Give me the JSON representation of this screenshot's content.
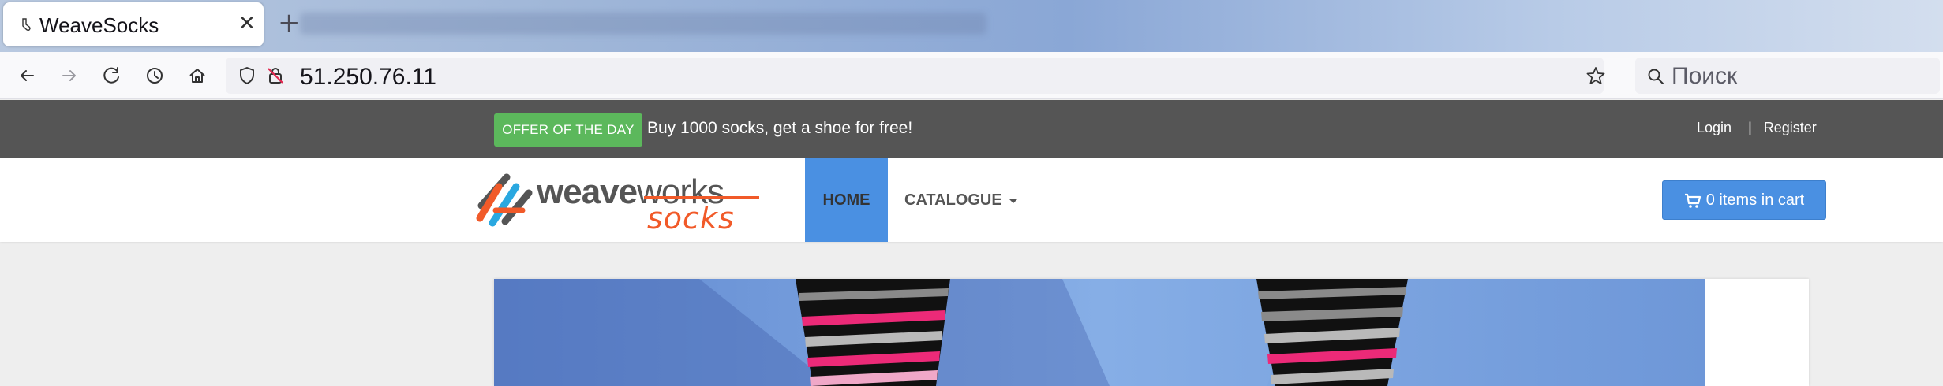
{
  "browser": {
    "tab_title": "WeaveSocks",
    "close_glyph": "✕",
    "new_tab_glyph": "+",
    "url": "51.250.76.11",
    "search_placeholder": "Поиск",
    "icons": [
      "back-icon",
      "forward-icon",
      "reload-icon",
      "history-icon",
      "home-icon",
      "shield-icon",
      "insecure-lock-icon",
      "bookmark-star-icon",
      "search-icon"
    ]
  },
  "topbar": {
    "offer_badge": "OFFER OF THE DAY",
    "offer_text": "Buy 1000 socks, get a shoe for free!",
    "login": "Login",
    "separator": "|",
    "register": "Register"
  },
  "logo": {
    "weave": "weave",
    "works": "works",
    "socks": "socks"
  },
  "nav": {
    "home": "HOME",
    "catalogue": "CATALOGUE",
    "cart": "0 items in cart"
  },
  "colors": {
    "accent_blue": "#4a90e2",
    "offer_green": "#5cb85c",
    "topbar_gray": "#555555",
    "logo_orange": "#f15a29"
  }
}
